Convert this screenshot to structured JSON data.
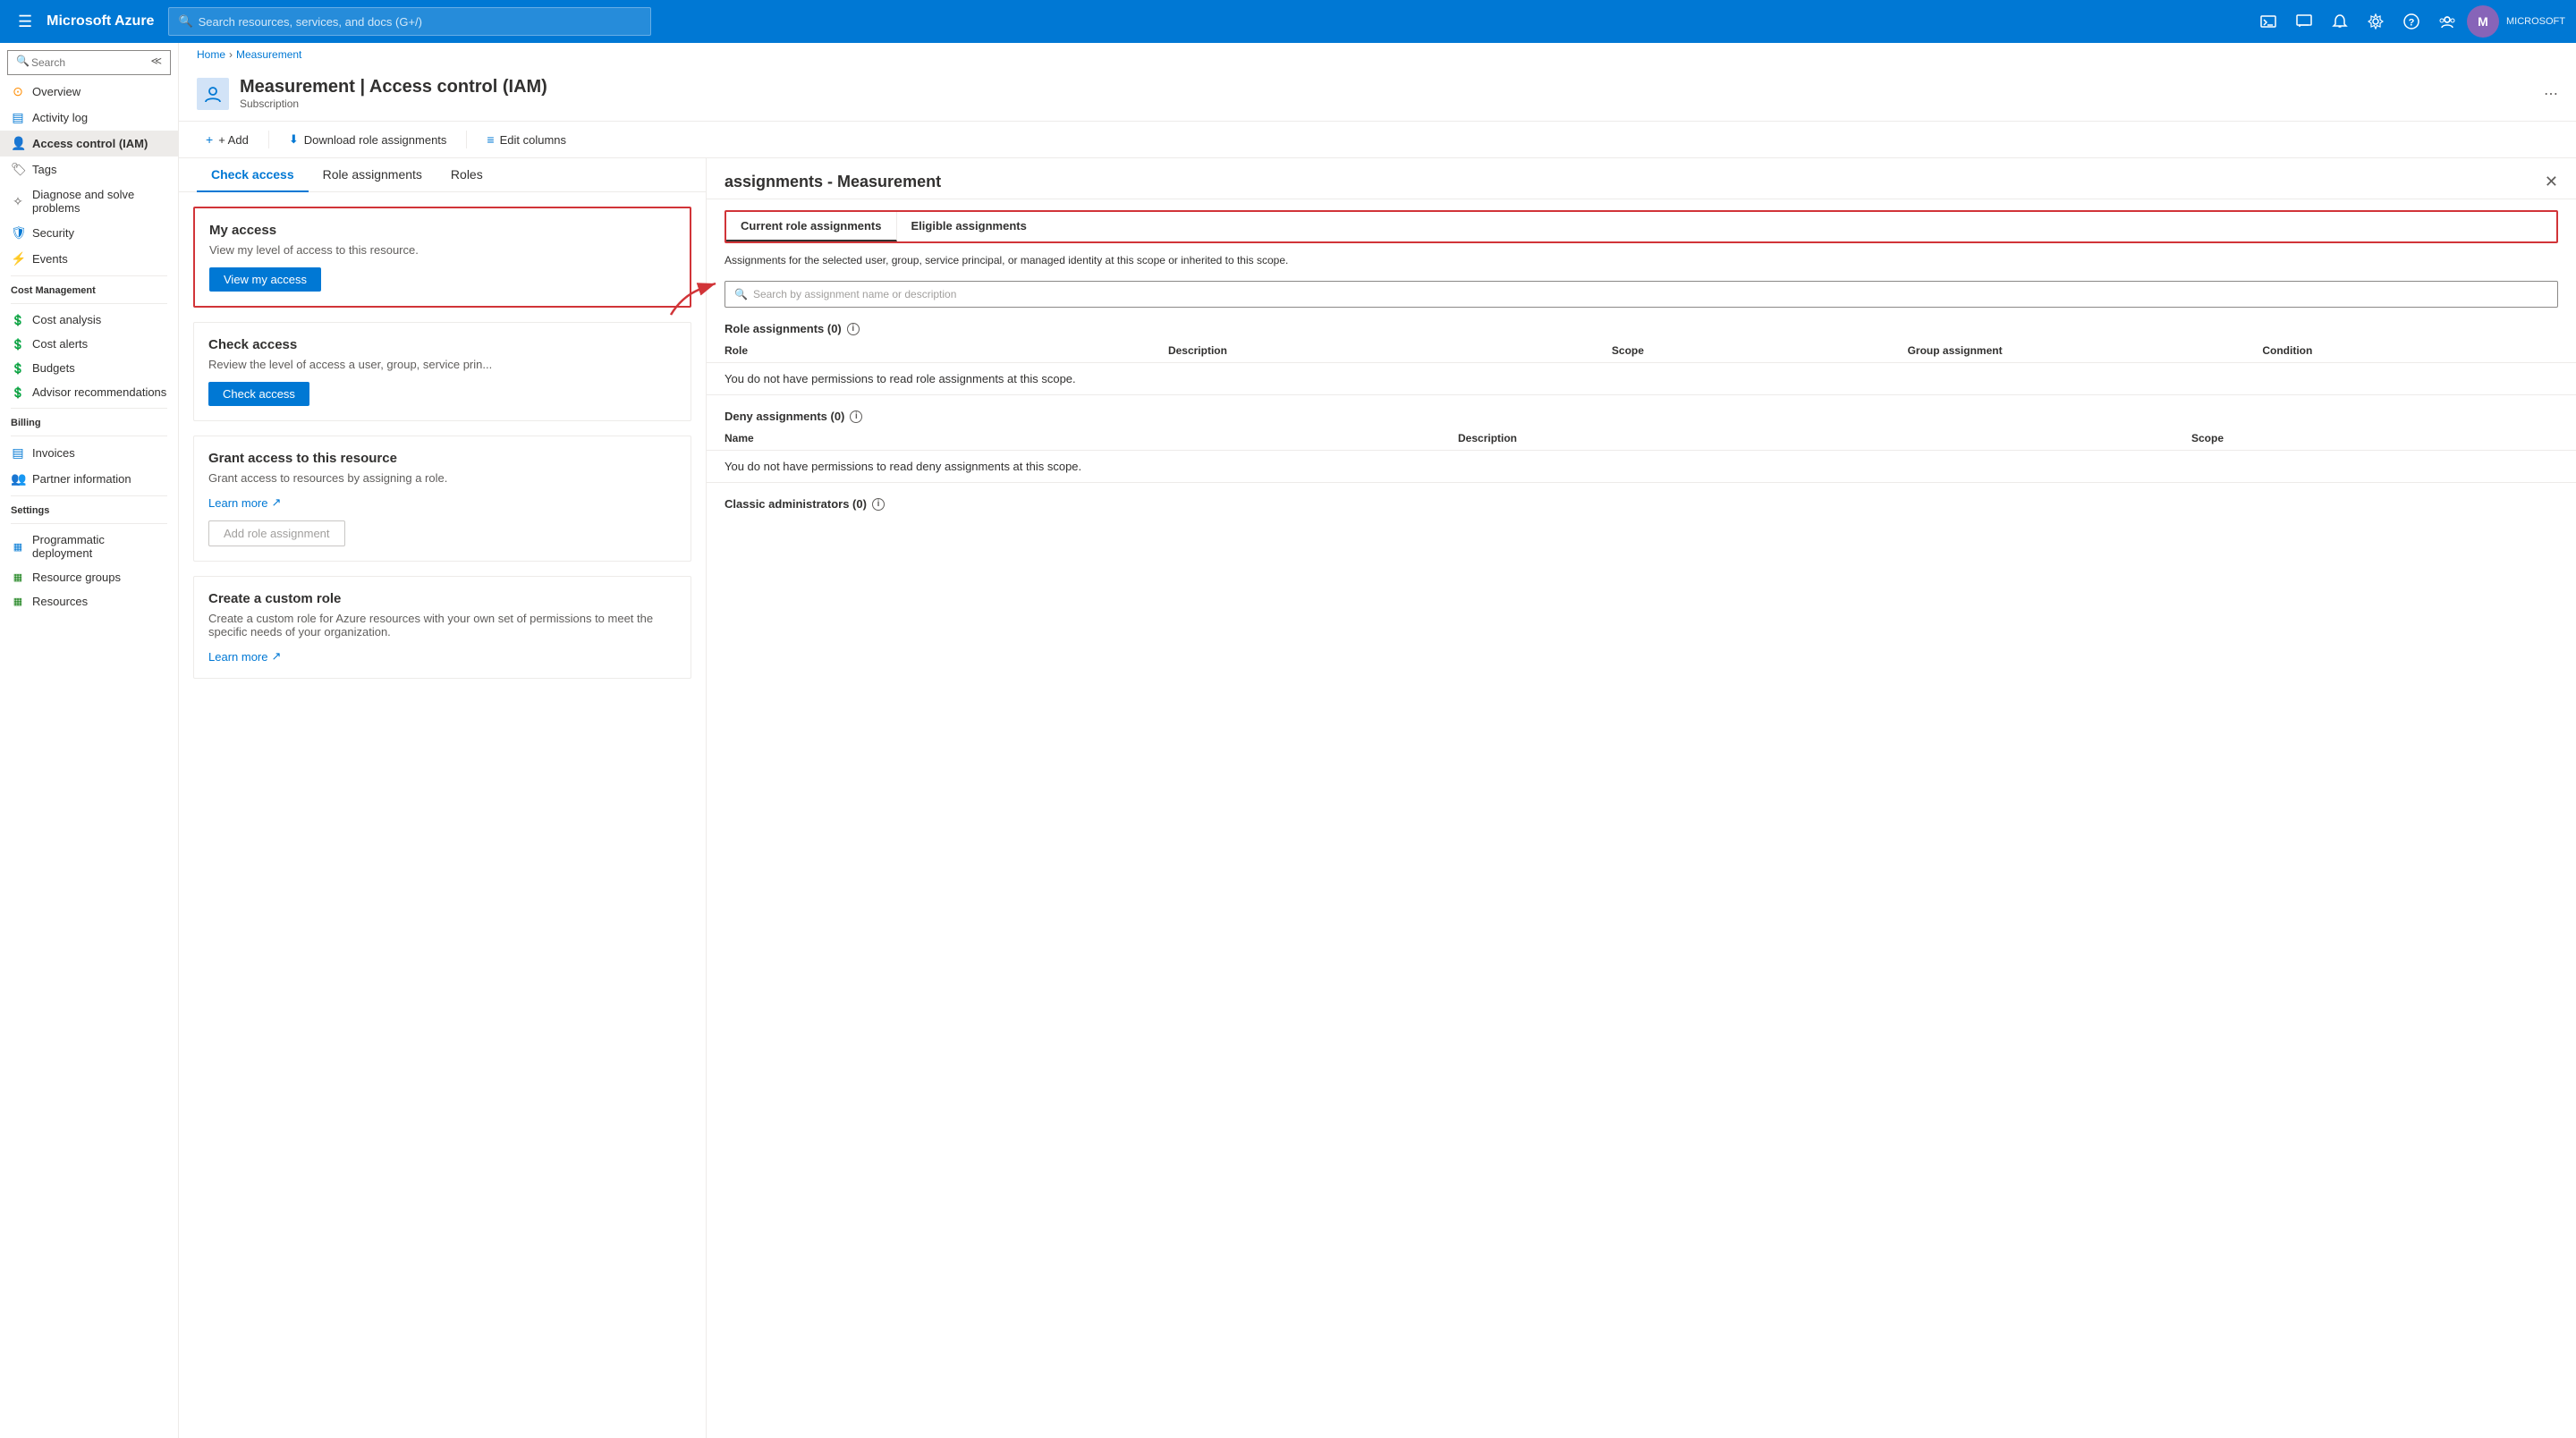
{
  "topNav": {
    "logoText": "Microsoft Azure",
    "searchPlaceholder": "Search resources, services, and docs (G+/)",
    "userLabel": "MICROSOFT",
    "userInitial": "M"
  },
  "breadcrumb": {
    "items": [
      "Home",
      "Measurement"
    ]
  },
  "pageHeader": {
    "title": "Measurement | Access control (IAM)",
    "subtitle": "Subscription"
  },
  "toolbar": {
    "addLabel": "+ Add",
    "downloadLabel": "Download role assignments",
    "editColumnsLabel": "Edit columns"
  },
  "tabs": {
    "items": [
      "Check access",
      "Role assignments",
      "Roles"
    ]
  },
  "cards": {
    "myAccess": {
      "title": "My access",
      "description": "View my level of access to this resource.",
      "buttonLabel": "View my access"
    },
    "checkAccess": {
      "title": "Check access",
      "description": "Review the level of access a user, group, service prin...",
      "buttonLabel": "Check access"
    },
    "grantAccess": {
      "title": "Grant access to this resource",
      "description": "Grant access to resources by assigning a role.",
      "linkText": "Learn more",
      "buttonLabel": "Add role assignment"
    },
    "customRole": {
      "title": "Create a custom role",
      "description": "Create a custom role for Azure resources with your own set of permissions to meet the specific needs of your organization.",
      "linkText": "Learn more"
    }
  },
  "rightPanel": {
    "title": "assignments - Measurement",
    "tabs": {
      "current": "Current role assignments",
      "eligible": "Eligible assignments"
    },
    "description": "Assignments for the selected user, group, service principal, or managed identity at this scope or inherited to this scope.",
    "searchPlaceholder": "Search by assignment name or description",
    "roleAssignments": {
      "label": "Role assignments (0)",
      "columns": [
        "Role",
        "Description",
        "Scope",
        "Group assignment",
        "Condition"
      ],
      "message": "You do not have permissions to read role assignments at this scope."
    },
    "denyAssignments": {
      "label": "Deny assignments (0)",
      "columns": [
        "Name",
        "Description",
        "Scope"
      ],
      "message": "You do not have permissions to read deny assignments at this scope."
    },
    "classicAdmins": {
      "label": "Classic administrators (0)"
    }
  },
  "sidebar": {
    "searchPlaceholder": "Search",
    "items": [
      {
        "label": "Overview",
        "icon": "⊙",
        "color": "#ff8c00"
      },
      {
        "label": "Activity log",
        "icon": "▤",
        "color": "#0078d4"
      },
      {
        "label": "Access control (IAM)",
        "icon": "👤",
        "color": "#0078d4",
        "active": true
      },
      {
        "label": "Tags",
        "icon": "🏷",
        "color": "#605e5c"
      },
      {
        "label": "Diagnose and solve problems",
        "icon": "✧",
        "color": "#605e5c"
      }
    ],
    "sections": [
      {
        "label": "Cost Management",
        "items": [
          {
            "label": "Cost analysis",
            "icon": "💲",
            "color": "#107c10"
          },
          {
            "label": "Cost alerts",
            "icon": "💲",
            "color": "#107c10"
          },
          {
            "label": "Budgets",
            "icon": "💲",
            "color": "#107c10"
          },
          {
            "label": "Advisor recommendations",
            "icon": "💲",
            "color": "#107c10"
          }
        ]
      },
      {
        "label": "Billing",
        "items": [
          {
            "label": "Invoices",
            "icon": "▤",
            "color": "#0078d4"
          },
          {
            "label": "Partner information",
            "icon": "👥",
            "color": "#605e5c"
          }
        ]
      },
      {
        "label": "Settings",
        "items": [
          {
            "label": "Programmatic deployment",
            "icon": "▦",
            "color": "#0078d4"
          },
          {
            "label": "Resource groups",
            "icon": "▦",
            "color": "#107c10"
          },
          {
            "label": "Resources",
            "icon": "▦",
            "color": "#107c10"
          }
        ]
      }
    ],
    "security": {
      "label": "Security",
      "icon": "🛡",
      "color": "#0078d4"
    },
    "events": {
      "label": "Events",
      "icon": "⚡",
      "color": "#ff8c00"
    }
  }
}
